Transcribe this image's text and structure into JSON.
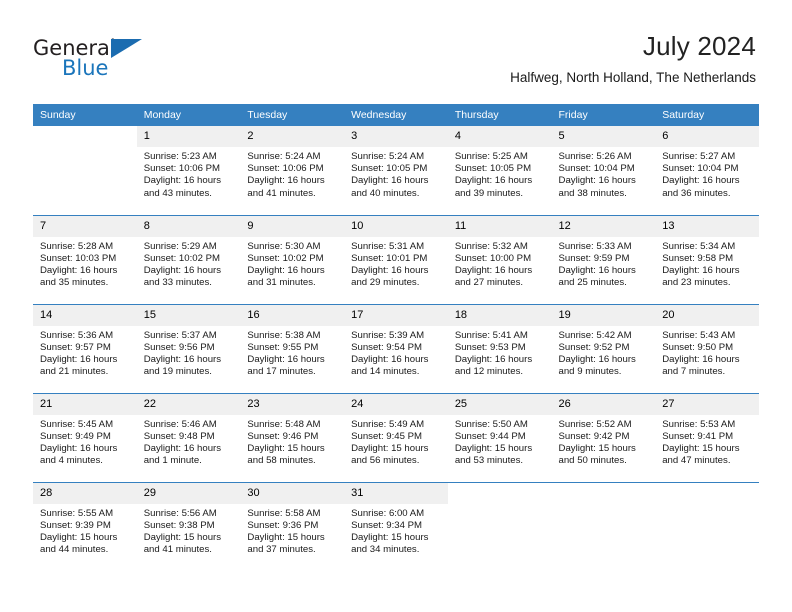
{
  "brand": {
    "name_part1": "General",
    "name_part2": "Blue",
    "accent_color": "#1b75bb",
    "triangle_color": "#1b6cb0"
  },
  "header": {
    "title": "July 2024",
    "location": "Halfweg, North Holland, The Netherlands"
  },
  "theme": {
    "header_bar_color": "#3580c0",
    "daynum_band_color": "#f0f0f0",
    "text_color": "#1a1a1a"
  },
  "calendar": {
    "weekday_headers": [
      "Sunday",
      "Monday",
      "Tuesday",
      "Wednesday",
      "Thursday",
      "Friday",
      "Saturday"
    ],
    "weeks": [
      [
        {
          "day": "",
          "blank": true,
          "lines": []
        },
        {
          "day": "1",
          "lines": [
            "Sunrise: 5:23 AM",
            "Sunset: 10:06 PM",
            "Daylight: 16 hours",
            "and 43 minutes."
          ]
        },
        {
          "day": "2",
          "lines": [
            "Sunrise: 5:24 AM",
            "Sunset: 10:06 PM",
            "Daylight: 16 hours",
            "and 41 minutes."
          ]
        },
        {
          "day": "3",
          "lines": [
            "Sunrise: 5:24 AM",
            "Sunset: 10:05 PM",
            "Daylight: 16 hours",
            "and 40 minutes."
          ]
        },
        {
          "day": "4",
          "lines": [
            "Sunrise: 5:25 AM",
            "Sunset: 10:05 PM",
            "Daylight: 16 hours",
            "and 39 minutes."
          ]
        },
        {
          "day": "5",
          "lines": [
            "Sunrise: 5:26 AM",
            "Sunset: 10:04 PM",
            "Daylight: 16 hours",
            "and 38 minutes."
          ]
        },
        {
          "day": "6",
          "lines": [
            "Sunrise: 5:27 AM",
            "Sunset: 10:04 PM",
            "Daylight: 16 hours",
            "and 36 minutes."
          ]
        }
      ],
      [
        {
          "day": "7",
          "lines": [
            "Sunrise: 5:28 AM",
            "Sunset: 10:03 PM",
            "Daylight: 16 hours",
            "and 35 minutes."
          ]
        },
        {
          "day": "8",
          "lines": [
            "Sunrise: 5:29 AM",
            "Sunset: 10:02 PM",
            "Daylight: 16 hours",
            "and 33 minutes."
          ]
        },
        {
          "day": "9",
          "lines": [
            "Sunrise: 5:30 AM",
            "Sunset: 10:02 PM",
            "Daylight: 16 hours",
            "and 31 minutes."
          ]
        },
        {
          "day": "10",
          "lines": [
            "Sunrise: 5:31 AM",
            "Sunset: 10:01 PM",
            "Daylight: 16 hours",
            "and 29 minutes."
          ]
        },
        {
          "day": "11",
          "lines": [
            "Sunrise: 5:32 AM",
            "Sunset: 10:00 PM",
            "Daylight: 16 hours",
            "and 27 minutes."
          ]
        },
        {
          "day": "12",
          "lines": [
            "Sunrise: 5:33 AM",
            "Sunset: 9:59 PM",
            "Daylight: 16 hours",
            "and 25 minutes."
          ]
        },
        {
          "day": "13",
          "lines": [
            "Sunrise: 5:34 AM",
            "Sunset: 9:58 PM",
            "Daylight: 16 hours",
            "and 23 minutes."
          ]
        }
      ],
      [
        {
          "day": "14",
          "lines": [
            "Sunrise: 5:36 AM",
            "Sunset: 9:57 PM",
            "Daylight: 16 hours",
            "and 21 minutes."
          ]
        },
        {
          "day": "15",
          "lines": [
            "Sunrise: 5:37 AM",
            "Sunset: 9:56 PM",
            "Daylight: 16 hours",
            "and 19 minutes."
          ]
        },
        {
          "day": "16",
          "lines": [
            "Sunrise: 5:38 AM",
            "Sunset: 9:55 PM",
            "Daylight: 16 hours",
            "and 17 minutes."
          ]
        },
        {
          "day": "17",
          "lines": [
            "Sunrise: 5:39 AM",
            "Sunset: 9:54 PM",
            "Daylight: 16 hours",
            "and 14 minutes."
          ]
        },
        {
          "day": "18",
          "lines": [
            "Sunrise: 5:41 AM",
            "Sunset: 9:53 PM",
            "Daylight: 16 hours",
            "and 12 minutes."
          ]
        },
        {
          "day": "19",
          "lines": [
            "Sunrise: 5:42 AM",
            "Sunset: 9:52 PM",
            "Daylight: 16 hours",
            "and 9 minutes."
          ]
        },
        {
          "day": "20",
          "lines": [
            "Sunrise: 5:43 AM",
            "Sunset: 9:50 PM",
            "Daylight: 16 hours",
            "and 7 minutes."
          ]
        }
      ],
      [
        {
          "day": "21",
          "lines": [
            "Sunrise: 5:45 AM",
            "Sunset: 9:49 PM",
            "Daylight: 16 hours",
            "and 4 minutes."
          ]
        },
        {
          "day": "22",
          "lines": [
            "Sunrise: 5:46 AM",
            "Sunset: 9:48 PM",
            "Daylight: 16 hours",
            "and 1 minute."
          ]
        },
        {
          "day": "23",
          "lines": [
            "Sunrise: 5:48 AM",
            "Sunset: 9:46 PM",
            "Daylight: 15 hours",
            "and 58 minutes."
          ]
        },
        {
          "day": "24",
          "lines": [
            "Sunrise: 5:49 AM",
            "Sunset: 9:45 PM",
            "Daylight: 15 hours",
            "and 56 minutes."
          ]
        },
        {
          "day": "25",
          "lines": [
            "Sunrise: 5:50 AM",
            "Sunset: 9:44 PM",
            "Daylight: 15 hours",
            "and 53 minutes."
          ]
        },
        {
          "day": "26",
          "lines": [
            "Sunrise: 5:52 AM",
            "Sunset: 9:42 PM",
            "Daylight: 15 hours",
            "and 50 minutes."
          ]
        },
        {
          "day": "27",
          "lines": [
            "Sunrise: 5:53 AM",
            "Sunset: 9:41 PM",
            "Daylight: 15 hours",
            "and 47 minutes."
          ]
        }
      ],
      [
        {
          "day": "28",
          "lines": [
            "Sunrise: 5:55 AM",
            "Sunset: 9:39 PM",
            "Daylight: 15 hours",
            "and 44 minutes."
          ]
        },
        {
          "day": "29",
          "lines": [
            "Sunrise: 5:56 AM",
            "Sunset: 9:38 PM",
            "Daylight: 15 hours",
            "and 41 minutes."
          ]
        },
        {
          "day": "30",
          "lines": [
            "Sunrise: 5:58 AM",
            "Sunset: 9:36 PM",
            "Daylight: 15 hours",
            "and 37 minutes."
          ]
        },
        {
          "day": "31",
          "lines": [
            "Sunrise: 6:00 AM",
            "Sunset: 9:34 PM",
            "Daylight: 15 hours",
            "and 34 minutes."
          ]
        },
        {
          "day": "",
          "blank": true,
          "lines": []
        },
        {
          "day": "",
          "blank": true,
          "lines": []
        },
        {
          "day": "",
          "blank": true,
          "lines": []
        }
      ]
    ]
  }
}
